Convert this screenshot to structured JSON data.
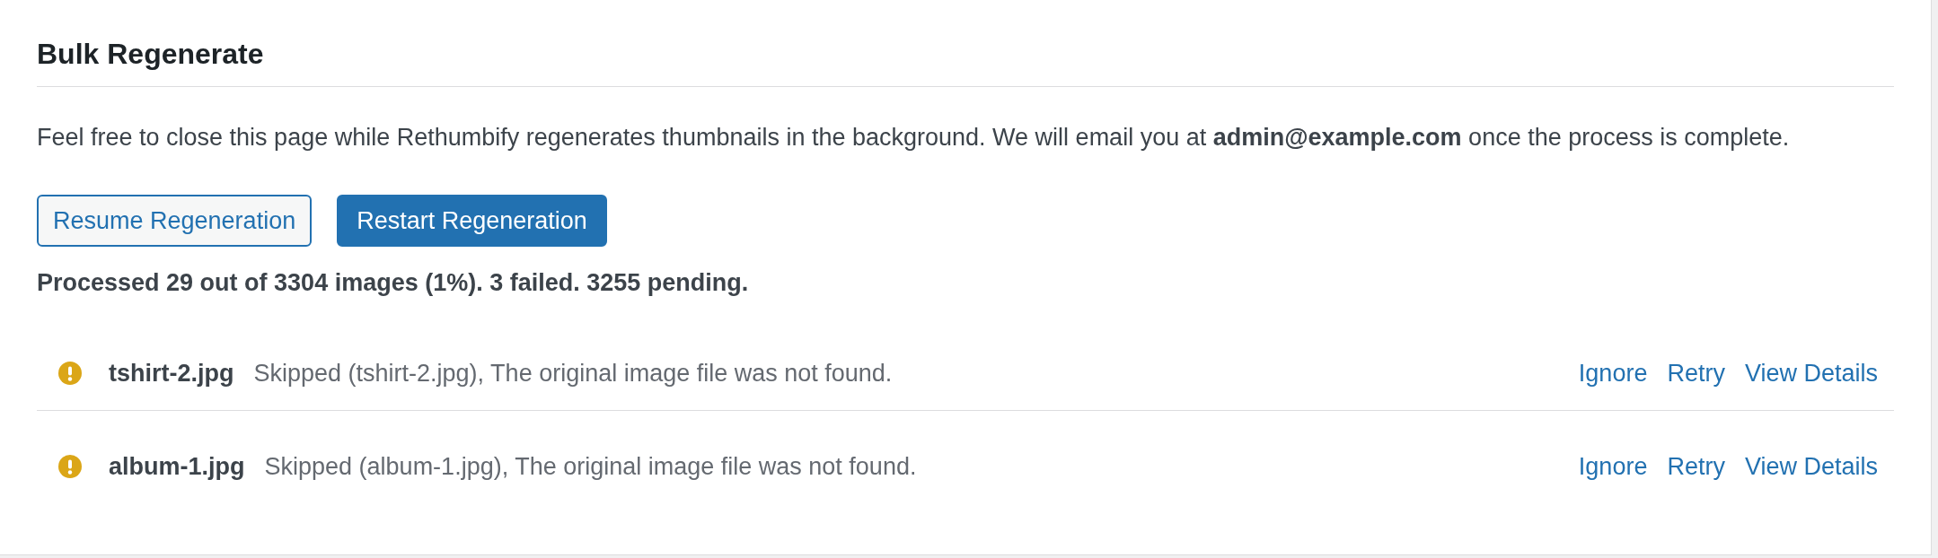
{
  "title": "Bulk Regenerate",
  "notice": "Feel free to close this page while Rethumbify regenerates thumbnails in the background. We will email you at **admin@example.com** once the process is complete.",
  "buttons": [
    {
      "label": "Resume Regeneration",
      "kind": "secondary"
    },
    {
      "label": "Restart Regeneration",
      "kind": "primary"
    }
  ],
  "progress_summary": "Processed 29 out of 3304 images (1%). 3 failed. 3255 pending.",
  "failures": [
    {
      "file": "tshirt-2.jpg",
      "message": "Skipped (tshirt-2.jpg), The original image file was not found.",
      "actions": [
        "Ignore",
        "Retry",
        "View Details"
      ]
    },
    {
      "file": "album-1.jpg",
      "message": "Skipped (album-1.jpg), The original image file was not found.",
      "actions": [
        "Ignore",
        "Retry",
        "View Details"
      ]
    }
  ]
}
